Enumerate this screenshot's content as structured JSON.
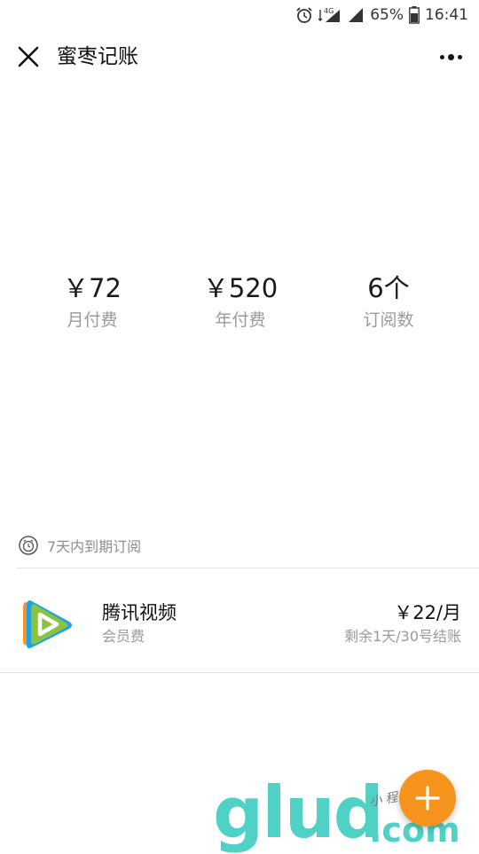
{
  "status_bar": {
    "network": "4G",
    "battery": "65%",
    "time": "16:41"
  },
  "nav": {
    "title": "蜜枣记账"
  },
  "stats": [
    {
      "value": "￥72",
      "label": "月付费"
    },
    {
      "value": "￥520",
      "label": "年付费"
    },
    {
      "value": "6个",
      "label": "订阅数"
    }
  ],
  "section": {
    "title": "7天内到期订阅"
  },
  "subscriptions": [
    {
      "name": "腾讯视频",
      "category": "会员费",
      "price": "￥22/月",
      "due": "剩余1天/30号结账",
      "icon": "tencent-video-icon"
    }
  ],
  "watermark": {
    "main": "glud",
    "suffix": ".com",
    "tagline": "小程序商店"
  },
  "colors": {
    "fab": "#f7941d",
    "watermark": "#4fd1c5",
    "secondary_text": "#9a9a9a"
  }
}
